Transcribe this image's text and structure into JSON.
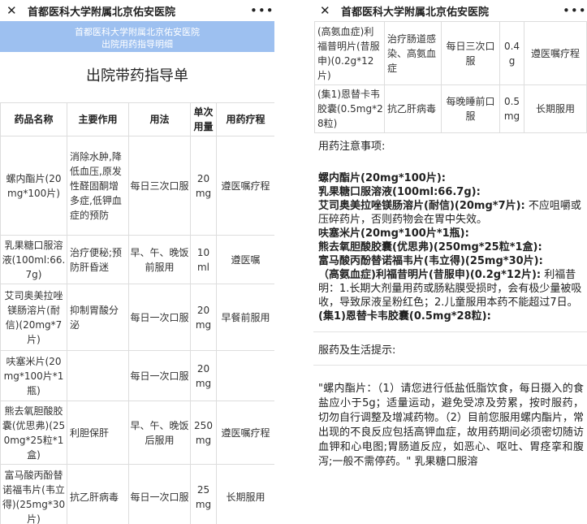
{
  "window": {
    "title": "首都医科大学附属北京佑安医院",
    "close_icon": "close-icon",
    "more_icon": "more-dots-icon"
  },
  "banner": {
    "line1": "首都医科大学附属北京佑安医院",
    "line2": "出院用药指导明细"
  },
  "page_title": "出院带药指导单",
  "table": {
    "headers": [
      "药品名称",
      "主要作用",
      "用法",
      "单次用量",
      "用药疗程"
    ],
    "rows": [
      {
        "name": "螺内酯片(20mg*100片)",
        "effect": "消除水肿,降低血压,原发性醛固酮增多症,低钾血症的预防",
        "usage": "每日三次口服",
        "dose": "20 mg",
        "course": "遵医嘱疗程"
      },
      {
        "name": "乳果糖口服溶液(100ml:66.7g)",
        "effect": "治疗便秘;预防肝昏迷",
        "usage": "早、午、晚饭前服用",
        "dose": "10 ml",
        "course": "遵医嘱"
      },
      {
        "name": "艾司奥美拉唑镁肠溶片(耐信)(20mg*7片)",
        "effect": "抑制胃酸分泌",
        "usage": "每日一次口服",
        "dose": "20 mg",
        "course": "早餐前服用"
      },
      {
        "name": "呋塞米片(20mg*100片*1瓶)",
        "effect": "",
        "usage": "每日一次口服",
        "dose": "20 mg",
        "course": ""
      },
      {
        "name": "熊去氧胆酸胶囊(优思弗)(250mg*25粒*1盒)",
        "effect": "利胆保肝",
        "usage": "早、午、晚饭后服用",
        "dose": "250 mg",
        "course": "遵医嘱疗程"
      },
      {
        "name": "富马酸丙酚替诺福韦片(韦立得)(25mg*30片)",
        "effect": "抗乙肝病毒",
        "usage": "每日一次口服",
        "dose": "25 mg",
        "course": "长期服用"
      },
      {
        "name": "(高氨血症)利福普明片(昔服申)(0.2g*12片)",
        "effect": "治疗肠道感染、高氨血症",
        "usage": "每日三次口服",
        "dose": "0.4 g",
        "course": "遵医嘱疗程"
      },
      {
        "name": "(集1)恩替卡韦胶囊(0.5mg*28粒)",
        "effect": "抗乙肝病毒",
        "usage": "每晚睡前口服",
        "dose": "0.5 mg",
        "course": "长期服用"
      }
    ]
  },
  "notes": {
    "heading": "用药注意事项:",
    "items": [
      {
        "drug": "螺内酯片(20mg*100片):",
        "text": ""
      },
      {
        "drug": "乳果糖口服溶液(100ml:66.7g):",
        "text": ""
      },
      {
        "drug": "艾司奥美拉唑镁肠溶片(耐信)(20mg*7片):",
        "text": " 不应咀嚼或压碎药片，否则药物会在胃中失效。"
      },
      {
        "drug": "呋塞米片(20mg*100片*1瓶):",
        "text": ""
      },
      {
        "drug": "熊去氧胆酸胶囊(优思弗)(250mg*25粒*1盒):",
        "text": ""
      },
      {
        "drug": "富马酸丙酚替诺福韦片(韦立得)(25mg*30片):",
        "text": ""
      },
      {
        "drug": "（高氨血症)利福昔明片(昔服申)(0.2g*12片):",
        "text": " 利福昔明：1.长期大剂量用药或肠粘膜受损时，会有极少量被吸收，导致尿液呈粉红色；2.儿童服用本药不能超过7日。"
      },
      {
        "drug": "(集1)恩替卡韦胶囊(0.5mg*28粒):",
        "text": ""
      }
    ]
  },
  "tips": {
    "heading": "服药及生活提示:",
    "body": "\"螺内酯片：（1）请您进行低盐低脂饮食，每日摄入的食盐应小于5g；适量运动，避免受凉及劳累，按时服药，切勿自行调整及增减药物。（2）目前您服用螺内酯片，常出现的不良反应包括高钾血症，故用药期间必须密切随访血钾和心电图;胃肠道反应，如恶心、呕吐、胃痉挛和腹泻;一般不需停药。\" 乳果糖口服溶"
  }
}
